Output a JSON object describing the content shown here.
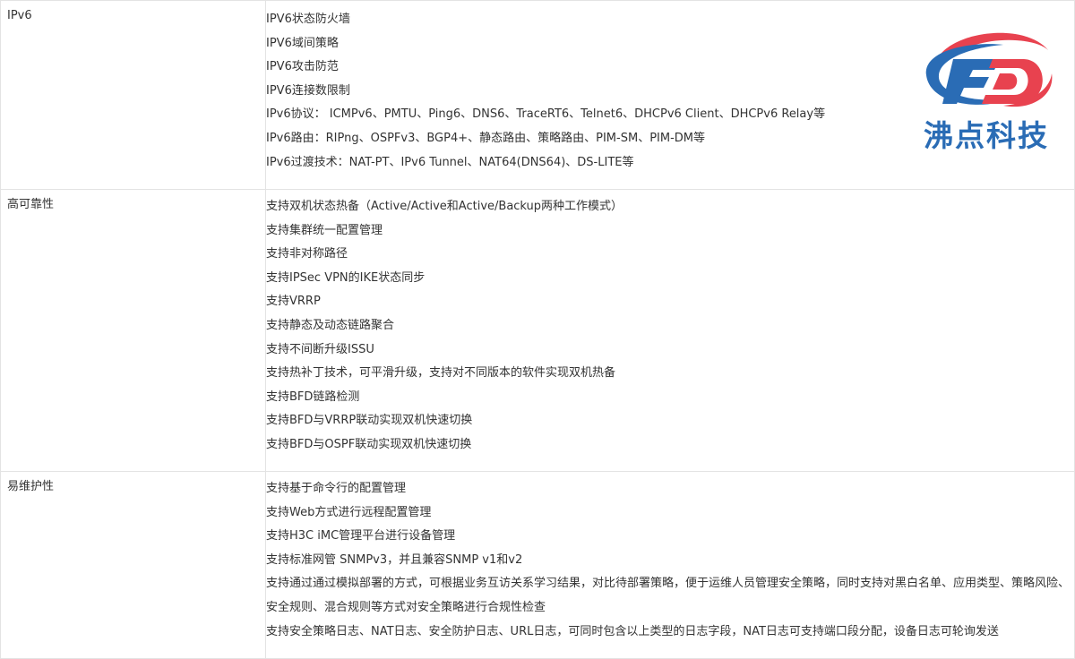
{
  "rows": [
    {
      "category": "IPv6",
      "features": [
        "IPV6状态防火墙",
        "IPV6域间策略",
        "IPV6攻击防范",
        "IPV6连接数限制",
        "IPv6协议： ICMPv6、PMTU、Ping6、DNS6、TraceRT6、Telnet6、DHCPv6 Client、DHCPv6 Relay等",
        "IPv6路由：RIPng、OSPFv3、BGP4+、静态路由、策略路由、PIM-SM、PIM-DM等",
        "IPv6过渡技术：NAT-PT、IPv6 Tunnel、NAT64(DNS64)、DS-LITE等"
      ]
    },
    {
      "category": "高可靠性",
      "features": [
        "支持双机状态热备（Active/Active和Active/Backup两种工作模式）",
        "支持集群统一配置管理",
        "支持非对称路径",
        "支持IPSec VPN的IKE状态同步",
        "支持VRRP",
        "支持静态及动态链路聚合",
        "支持不间断升级ISSU",
        "支持热补丁技术，可平滑升级，支持对不同版本的软件实现双机热备",
        "支持BFD链路检测",
        "支持BFD与VRRP联动实现双机快速切换",
        "支持BFD与OSPF联动实现双机快速切换"
      ]
    },
    {
      "category": "易维护性",
      "features": [
        "支持基于命令行的配置管理",
        "支持Web方式进行远程配置管理",
        "支持H3C iMC管理平台进行设备管理",
        "支持标准网管 SNMPv3，并且兼容SNMP v1和v2",
        "支持通过通过模拟部署的方式，可根据业务互访关系学习结果，对比待部署策略，便于运维人员管理安全策略，同时支持对黑白名单、应用类型、策略风险、安全规则、混合规则等方式对安全策略进行合规性检查",
        "支持安全策略日志、NAT日志、安全防护日志、URL日志，可同时包含以上类型的日志字段，NAT日志可支持端口段分配，设备日志可轮询发送"
      ]
    }
  ],
  "logo": {
    "text": "沸点科技",
    "letters": "FD",
    "colors": {
      "red": "#e8424f",
      "blue": "#2a6cb5"
    }
  }
}
